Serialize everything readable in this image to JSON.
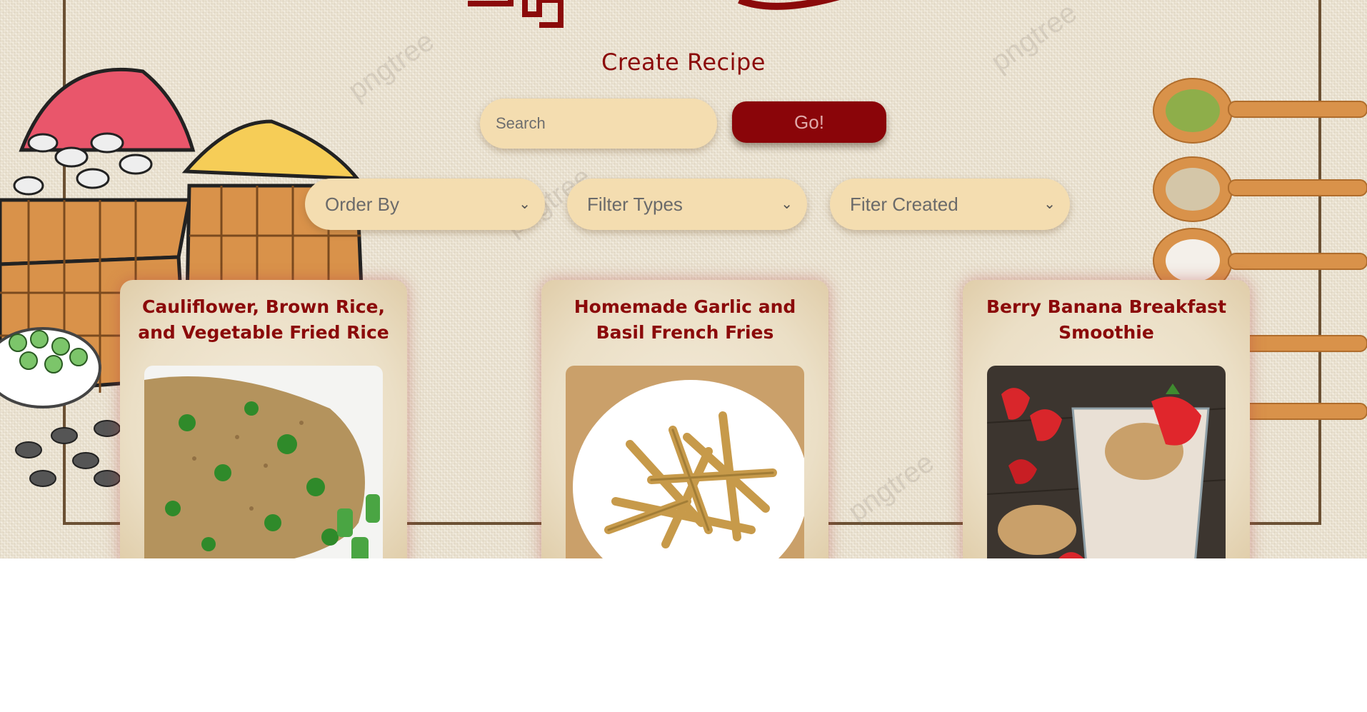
{
  "header": {
    "create_link": "Create Recipe"
  },
  "search": {
    "placeholder": "Search",
    "button_label": "Go!"
  },
  "filters": {
    "order_by": "Order By",
    "filter_types": "Filter Types",
    "filter_created": "Fiter Created"
  },
  "recipes": [
    {
      "title": "Cauliflower, Brown Rice, and Vegetable Fried Rice",
      "image": "fried-rice-photo"
    },
    {
      "title": "Homemade Garlic and Basil French Fries",
      "image": "french-fries-photo"
    },
    {
      "title": "Berry Banana Breakfast Smoothie",
      "image": "smoothie-photo"
    }
  ],
  "colors": {
    "accent": "#8b0a0a",
    "input_bg": "#f4ddb0",
    "button_bg": "#8a0509"
  }
}
